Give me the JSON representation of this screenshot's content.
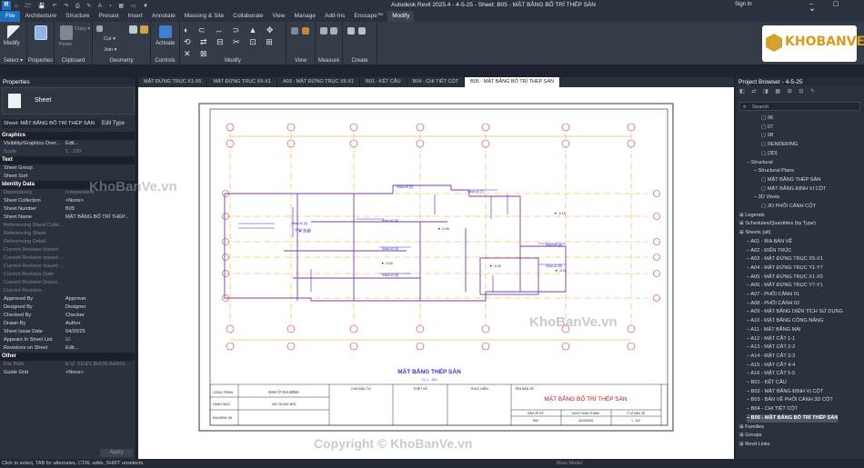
{
  "titlebar": {
    "app_title": "Autodesk Revit 2025.4 - 4-5-25 - Sheet: B05 - MẶT BẰNG BỐ TRÍ THÉP SÀN",
    "sign_in": "Sign In"
  },
  "ribbon_tabs": [
    "File",
    "Architecture",
    "Structure",
    "Precast",
    "Insert",
    "Annotate",
    "Massing & Site",
    "Collaborate",
    "View",
    "Manage",
    "Add-Ins",
    "Enscape™",
    "Modify"
  ],
  "ribbon": {
    "modify": "Modify",
    "select": "Select ▾",
    "properties": "Properties",
    "clipboard": "Clipboard",
    "geometry": "Geometry",
    "controls": "Controls",
    "activate": "Activate",
    "modify_group": "Modify",
    "view": "View",
    "measure": "Measure",
    "create": "Create",
    "cut": "Cut ▾",
    "join": "Join ▾",
    "copy": "Copy ▾",
    "paste": "Paste"
  },
  "doc_tabs": [
    "MẶT ĐỨNG TRỤC X1-X5",
    "MẶT ĐỨNG TRỤC X5-X1",
    "A03 - MẶT ĐỨNG TRỤC X5-X1",
    "B01 - KẾT CẤU",
    "B04 - CHI TIẾT CỘT",
    "B05 - MẶT BẰNG BỐ TRÍ THÉP SÀN"
  ],
  "properties": {
    "title": "Properties",
    "type_name": "Sheet",
    "instance_selector": "Sheet: MẶT BẰNG BỐ TRÍ THÉP SÀN",
    "edit_type": "Edit Type",
    "rows": [
      {
        "kind": "section",
        "label": "Graphics"
      },
      {
        "kind": "row",
        "k": "Visibility/Graphics Over...",
        "v": "Edit..."
      },
      {
        "kind": "row",
        "k": "Scale",
        "v": "1 : 100",
        "dim": true
      },
      {
        "kind": "section",
        "label": "Text"
      },
      {
        "kind": "row",
        "k": "Sheet Group",
        "v": ""
      },
      {
        "kind": "row",
        "k": "Sheet Sort",
        "v": ""
      },
      {
        "kind": "section",
        "label": "Identity Data"
      },
      {
        "kind": "row",
        "k": "Dependency",
        "v": "Independent",
        "dim": true
      },
      {
        "kind": "row",
        "k": "Sheet Collection",
        "v": "<None>"
      },
      {
        "kind": "row",
        "k": "Sheet Number",
        "v": "B05"
      },
      {
        "kind": "row",
        "k": "Sheet Name",
        "v": "MẶT BẰNG BỐ TRÍ THÉP..."
      },
      {
        "kind": "row",
        "k": "Referencing Sheet Colle...",
        "v": "",
        "dim": true
      },
      {
        "kind": "row",
        "k": "Referencing Sheet",
        "v": "",
        "dim": true
      },
      {
        "kind": "row",
        "k": "Referencing Detail",
        "v": "",
        "dim": true
      },
      {
        "kind": "row",
        "k": "Current Revision Issued",
        "v": "",
        "dim": true
      },
      {
        "kind": "row",
        "k": "Current Revision Issued ...",
        "v": "",
        "dim": true
      },
      {
        "kind": "row",
        "k": "Current Revision Issued ...",
        "v": "",
        "dim": true
      },
      {
        "kind": "row",
        "k": "Current Revision Date",
        "v": "",
        "dim": true
      },
      {
        "kind": "row",
        "k": "Current Revision Descri...",
        "v": "",
        "dim": true
      },
      {
        "kind": "row",
        "k": "Current Revision",
        "v": "",
        "dim": true
      },
      {
        "kind": "row",
        "k": "Approved By",
        "v": "Approver"
      },
      {
        "kind": "row",
        "k": "Designed By",
        "v": "Designer"
      },
      {
        "kind": "row",
        "k": "Checked By",
        "v": "Checker"
      },
      {
        "kind": "row",
        "k": "Drawn By",
        "v": "Author"
      },
      {
        "kind": "row",
        "k": "Sheet Issue Date",
        "v": "04/20/25"
      },
      {
        "kind": "row",
        "k": "Appears In Sheet List",
        "v": "☑"
      },
      {
        "kind": "row",
        "k": "Revisions on Sheet",
        "v": "Edit..."
      },
      {
        "kind": "section",
        "label": "Other"
      },
      {
        "kind": "row",
        "k": "File Path",
        "v": "E:\\Z. FILES BUON BAN\\D...",
        "dim": true
      },
      {
        "kind": "row",
        "k": "Guide Grid",
        "v": "<None>"
      }
    ],
    "apply": "Apply"
  },
  "browser": {
    "title": "Project Browser - 4-5-25",
    "search": "Search",
    "items": [
      {
        "t": "06",
        "l": 2
      },
      {
        "t": "07",
        "l": 2
      },
      {
        "t": "08",
        "l": 2
      },
      {
        "t": "RENDERING",
        "l": 2
      },
      {
        "t": "{3D}",
        "l": 2
      },
      {
        "t": "Structural",
        "l": 0
      },
      {
        "t": "Structural Plans",
        "l": 1
      },
      {
        "t": "MẶT BẰNG THÉP SÀN",
        "l": 2
      },
      {
        "t": "MẶT BẰNG ĐỊNH VỊ CỘT",
        "l": 2
      },
      {
        "t": "3D Views",
        "l": 1
      },
      {
        "t": "3D PHỐI CẢNH CỘT",
        "l": 2
      },
      {
        "t": "Legends",
        "l": -1
      },
      {
        "t": "Schedules/Quantities (by Type)",
        "l": -1
      },
      {
        "t": "Sheets (all)",
        "l": -1
      },
      {
        "t": "A01 - BÌA BẢN VẼ",
        "l": 0
      },
      {
        "t": "A02 - KIẾN TRÚC",
        "l": 0
      },
      {
        "t": "A03 - MẶT ĐỨNG TRỤC X5-X1",
        "l": 0
      },
      {
        "t": "A04 - MẶT ĐỨNG TRỤC Y1-Y7",
        "l": 0
      },
      {
        "t": "A05 - MẶT ĐỨNG TRỤC X1-X5",
        "l": 0
      },
      {
        "t": "A06 - MẶT ĐỨNG TRỤC Y7-Y1",
        "l": 0
      },
      {
        "t": "A07 - PHỐI CẢNH 01",
        "l": 0
      },
      {
        "t": "A08 - PHỐI CẢNH 02",
        "l": 0
      },
      {
        "t": "A09 - MẶT BẰNG DIỆN TÍCH SỬ DỤNG",
        "l": 0
      },
      {
        "t": "A10 - MẶT BẰNG CÔNG NĂNG",
        "l": 0
      },
      {
        "t": "A11 - MẶT BẰNG MÁI",
        "l": 0
      },
      {
        "t": "A12 - MẶT CẮT 1-1",
        "l": 0
      },
      {
        "t": "A13 - MẶT CẮT 2-2",
        "l": 0
      },
      {
        "t": "A14 - MẶT CẮT 3-3",
        "l": 0
      },
      {
        "t": "A15 - MẶT CẮT 4-4",
        "l": 0
      },
      {
        "t": "A16 - MẶT CẮT 5-5",
        "l": 0
      },
      {
        "t": "B01 - KẾT CẤU",
        "l": 0
      },
      {
        "t": "B02 - MẶT BẰNG ĐỊNH VỊ CỘT",
        "l": 0
      },
      {
        "t": "B03 - BẢN VẼ PHỐI CẢNH 3D CỘT",
        "l": 0
      },
      {
        "t": "B04 - CHI TIẾT CỘT",
        "l": 0
      },
      {
        "t": "B05 - MẶT BẰNG BỐ TRÍ THÉP SÀN",
        "l": 0,
        "sel": true
      },
      {
        "t": "Families",
        "l": -1
      },
      {
        "t": "Groups",
        "l": -1
      },
      {
        "t": "Revit Links",
        "l": -1
      }
    ]
  },
  "drawing": {
    "plan_title": "MẶT BẰNG THÉP SÀN",
    "plan_scale": "TL 1 : 100",
    "tb_cong_trinh": "CÔNG TRÌNH",
    "tb_cong_trinh_val": "NHÀ Ở GIA ĐÌNH",
    "tb_hang_muc": "HẠNG MỤC",
    "tb_hang_muc_val": "XÂY DỰNG MỚI",
    "tb_dia_diem": "ĐỊA ĐIỂM XD",
    "tb_chu_dau_tu": "CHỦ ĐẦU TƯ",
    "tb_thiet_ke": "THIẾT KẾ",
    "tb_thuc_hien": "THỰC HIỆN",
    "tb_ten_ban_ve": "TÊN BẢN VẼ",
    "tb_sheet_name": "MẶT BẰNG BỐ TRÍ THÉP SÀN",
    "tb_bv_so": "BẢN VẼ SỐ",
    "tb_ngay": "NGÀY HOÀN THÀNH",
    "tb_tyle": "TỈ LỆ BẢN VẼ",
    "tb_bv_so_val": "B05",
    "tb_ngay_val": "04/20/2025",
    "tb_tyle_val": "1 : 100"
  },
  "watermarks": {
    "w1": "KhoBanVe.vn",
    "w2": "KhoBanVe.vn",
    "w3": "Copyright © KhoBanVe.vn",
    "logo": "KHOBANVE"
  },
  "status": {
    "text": "Click to select, TAB for alternates, CTRL adds, SHIFT unselects.",
    "main_model": "Main Model"
  }
}
